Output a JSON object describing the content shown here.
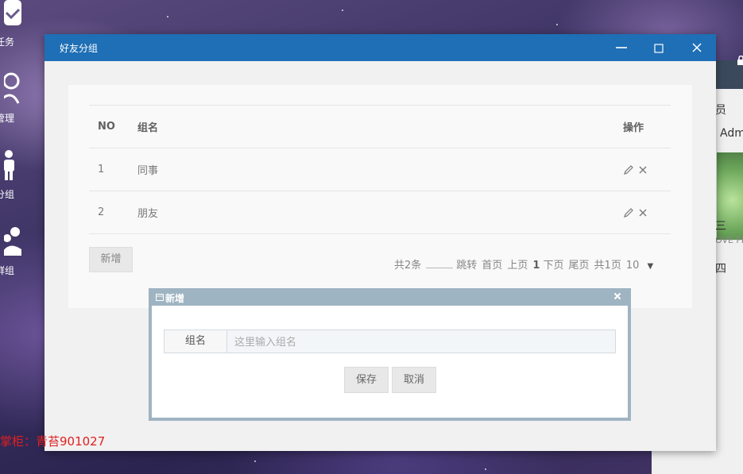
{
  "desktop": {
    "icons": [
      {
        "label": "任务",
        "icon": "check-icon"
      },
      {
        "label": "管理",
        "icon": "user-outline-icon"
      },
      {
        "label": "分组",
        "icon": "person-icon"
      },
      {
        "label": "群组",
        "icon": "group-icon"
      }
    ],
    "watermark": "掌柜：青苔901027"
  },
  "background_window": {
    "texts": [
      "员",
      "Adm",
      "三",
      "OVE FH",
      "四"
    ]
  },
  "window": {
    "title": "好友分组",
    "controls": [
      "minimize",
      "maximize",
      "close"
    ],
    "table": {
      "headers": [
        "NO",
        "组名",
        "操作"
      ],
      "rows": [
        {
          "no": "1",
          "name": "同事"
        },
        {
          "no": "2",
          "name": "朋友"
        }
      ]
    },
    "add_button": "新增",
    "pager": {
      "total": "共2条",
      "jump": "跳转",
      "first": "首页",
      "prev": "上页",
      "current": "1",
      "next": "下页",
      "last": "尾页",
      "pages": "共1页",
      "page_size": "10"
    }
  },
  "dialog": {
    "title": "新增",
    "field_label": "组名",
    "field_placeholder": "这里输入组名",
    "field_value": "",
    "save": "保存",
    "cancel": "取消"
  },
  "colors": {
    "title_bar": "#1e6fb5",
    "dialog_bar": "#9fb4c2",
    "watermark": "#e02020"
  }
}
